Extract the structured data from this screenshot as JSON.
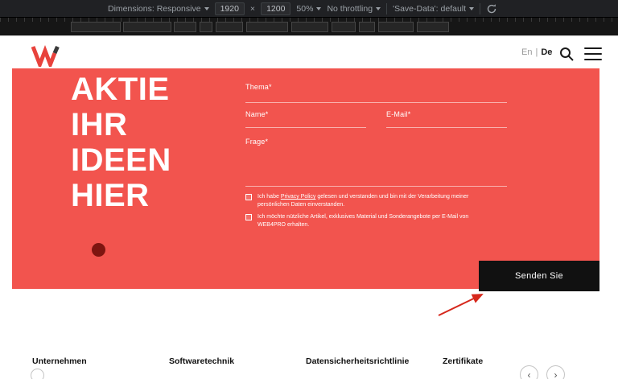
{
  "devtools": {
    "dimensions": "Dimensions: Responsive",
    "width": "1920",
    "times": "×",
    "height": "1200",
    "zoom": "50%",
    "throttling": "No throttling",
    "save_data": "'Save-Data': default"
  },
  "header": {
    "lang": {
      "en": "En",
      "divider": "|",
      "de": "De"
    }
  },
  "hero": {
    "headline": {
      "line1": "AKTIE",
      "line2": "IHR",
      "line3": "IDEEN",
      "line4": "HIER"
    },
    "form": {
      "thema_label": "Thema*",
      "name_label": "Name*",
      "email_label": "E-Mail*",
      "frage_label": "Frage*",
      "consent_pre": "Ich habe ",
      "consent_link": "Privacy Policy",
      "consent_post": " gelesen und verstanden und bin mit der Verarbeitung meiner persönlichen Daten einverstanden.",
      "newsletter": "Ich möchte nützliche Artikel, exklusives Material und Sonderangebote per E-Mail von WEB4PRO erhalten.",
      "submit": "Senden Sie"
    }
  },
  "footer": {
    "columns": [
      "Unternehmen",
      "Softwaretechnik",
      "Datensicherheitsrichtlinie",
      "Zertifikate"
    ],
    "carousel": {
      "prev": "‹",
      "next": "›"
    }
  },
  "colors": {
    "accent_red": "#f2544e",
    "devtools_bg": "#202124",
    "button_bg": "#111111",
    "annotation_red": "#d6281c"
  }
}
